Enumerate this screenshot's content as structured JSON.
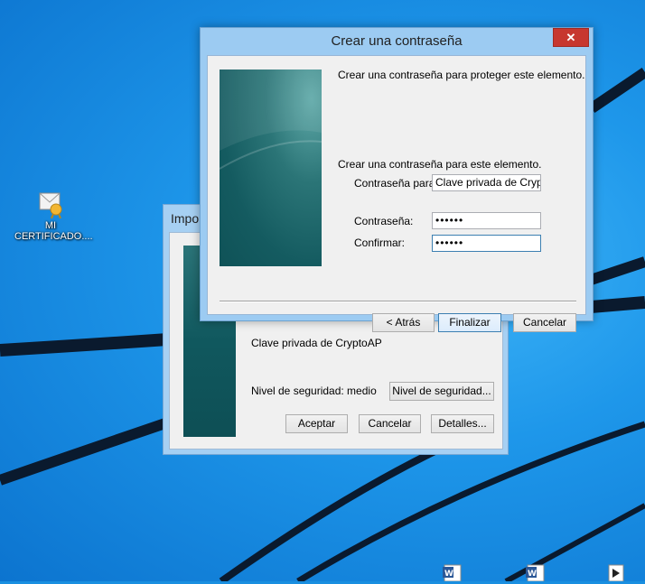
{
  "desktop": {
    "icon_label_line1": "MI",
    "icon_label_line2": "CERTIFICADO...."
  },
  "bg_dialog": {
    "title": "Impo",
    "key_label": "Clave privada de CryptoAP",
    "security_level_label": "Nivel de seguridad: medio",
    "security_level_button": "Nivel de seguridad...",
    "accept_button": "Aceptar",
    "cancel_button": "Cancelar",
    "details_button": "Detalles..."
  },
  "fg_dialog": {
    "title": "Crear una contraseña",
    "close_glyph": "✕",
    "intro_text": "Crear una contraseña para proteger este elemento.",
    "section_text": "Crear una contraseña para este elemento.",
    "password_for_label": "Contraseña para:",
    "password_for_value": "Clave privada de CryptoA",
    "password_label": "Contraseña:",
    "password_value": "••••••",
    "confirm_label": "Confirmar:",
    "confirm_value": "••••••",
    "back_button": "< Atrás",
    "finish_button": "Finalizar",
    "cancel_button": "Cancelar"
  },
  "colors": {
    "desktop_blue": "#1e97ea",
    "close_red": "#c7372f",
    "title_bar_blue": "#9ccbf2"
  }
}
